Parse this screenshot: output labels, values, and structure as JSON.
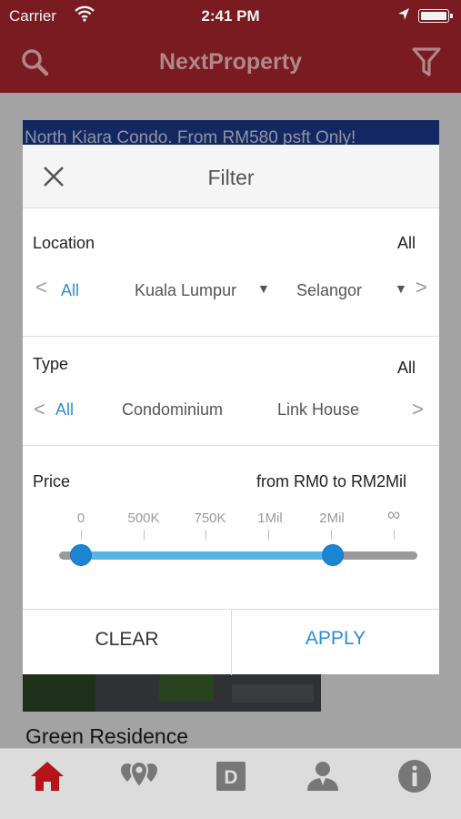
{
  "status_bar": {
    "carrier": "Carrier",
    "time": "2:41 PM"
  },
  "nav": {
    "title": "NextProperty"
  },
  "background": {
    "banner_text": "North Kiara Condo. From RM580 psft Only!",
    "listing_title": "Green Residence"
  },
  "filter": {
    "title": "Filter",
    "location": {
      "label": "Location",
      "value": "All",
      "options": [
        "All",
        "Kuala Lumpur",
        "Selangor"
      ],
      "selected": "All"
    },
    "type": {
      "label": "Type",
      "value": "All",
      "options": [
        "All",
        "Condominium",
        "Link House"
      ],
      "selected": "All"
    },
    "price": {
      "label": "Price",
      "value": "from RM0 to RM2Mil",
      "ticks": [
        "0",
        "500K",
        "750K",
        "1Mil",
        "2Mil",
        "∞"
      ],
      "range_min": "0",
      "range_max": "2Mil"
    },
    "clear_label": "CLEAR",
    "apply_label": "APPLY"
  },
  "tabbar": {
    "tabs": [
      {
        "icon": "home-icon",
        "active": true
      },
      {
        "icon": "map-pins-icon",
        "active": false
      },
      {
        "icon": "d-icon",
        "active": false
      },
      {
        "icon": "person-icon",
        "active": false
      },
      {
        "icon": "info-icon",
        "active": false
      }
    ]
  },
  "colors": {
    "brand": "#7a1a21",
    "accent": "#2a8fd6",
    "slider_fill": "#5ab4e2",
    "active_tab": "#b5141a"
  }
}
